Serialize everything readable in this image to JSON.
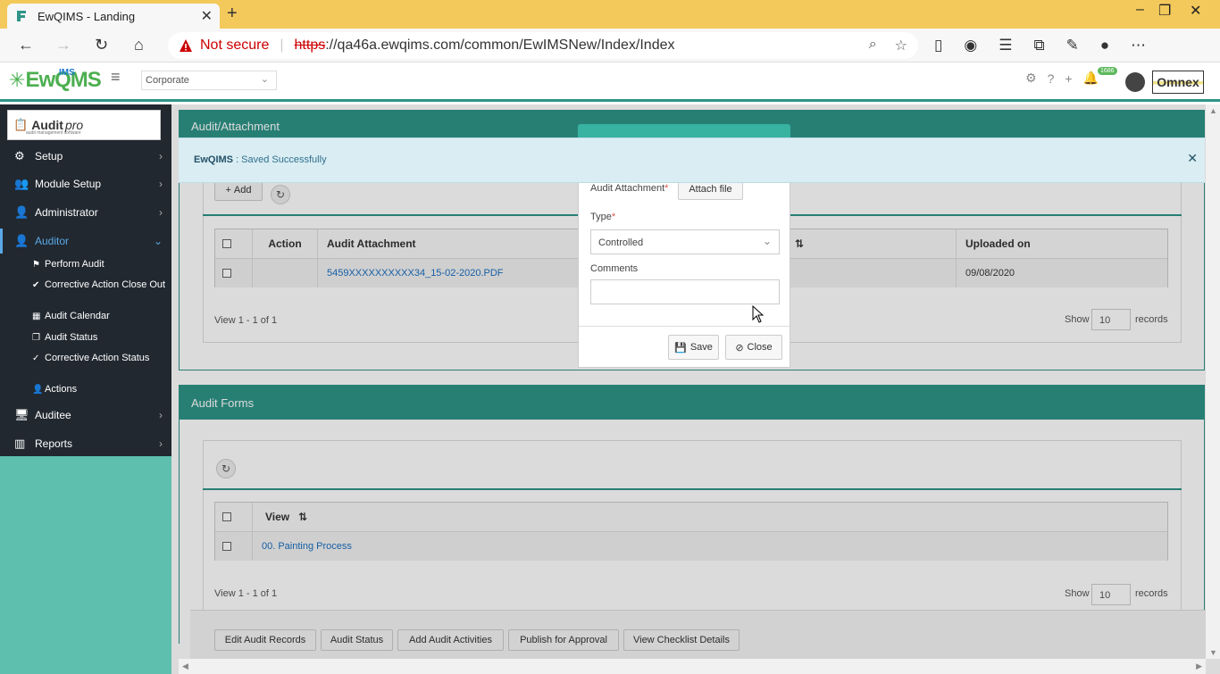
{
  "browser": {
    "tab_title": "EwQIMS - Landing",
    "not_secure": "Not secure",
    "url_scheme": "https",
    "url_rest": "://qa46a.ewqims.com/common/EwIMSNew/Index/Index"
  },
  "header": {
    "logo_sup": "IMS",
    "logo_main": "EwQMS",
    "corporate": "Corporate",
    "notif_count": "1686",
    "brand_logo": "Omnex"
  },
  "sidebar": {
    "logo_bold": "Audit",
    "logo_italic": "pro",
    "logo_tag": "audit management software",
    "items": [
      {
        "label": "Setup"
      },
      {
        "label": "Module Setup"
      },
      {
        "label": "Administrator"
      },
      {
        "label": "Auditor"
      },
      {
        "label": "Auditee"
      },
      {
        "label": "Reports"
      }
    ],
    "auditor_sub": [
      {
        "label": "Perform Audit"
      },
      {
        "label": "Corrective Action Close Out"
      },
      {
        "label": "Audit Calendar"
      },
      {
        "label": "Audit Status"
      },
      {
        "label": "Corrective Action Status"
      },
      {
        "label": "Actions"
      }
    ]
  },
  "attachment_panel": {
    "title": "Audit/Attachment",
    "add_label": "Add",
    "columns": [
      "Action",
      "Audit Attachment",
      "Uploaded on"
    ],
    "row": {
      "file": "5459XXXXXXXXXX34_15-02-2020.PDF",
      "uploaded": "09/08/2020"
    },
    "view_text": "View 1 - 1 of 1",
    "show_label": "Show",
    "show_value": "10",
    "records_label": "records"
  },
  "forms_panel": {
    "title": "Audit Forms",
    "column_view": "View",
    "row_link": "00. Painting Process",
    "view_text": "View 1 - 1 of 1",
    "show_label": "Show",
    "show_value": "10",
    "records_label": "records"
  },
  "bottom_buttons": [
    "Edit Audit Records",
    "Audit Status",
    "Add Audit Activities",
    "Publish for Approval",
    "View Checklist Details"
  ],
  "alert": {
    "app": "EwQIMS",
    "message": " : Saved Successfully"
  },
  "modal": {
    "attachment_label": "Audit Attachment",
    "attach_button": "Attach file",
    "type_label": "Type",
    "type_value": "Controlled",
    "comments_label": "Comments",
    "save_label": "Save",
    "close_label": "Close"
  },
  "colors": {
    "teal": "#2e9488",
    "sidebar": "#212830",
    "active": "#5aa9e6"
  }
}
